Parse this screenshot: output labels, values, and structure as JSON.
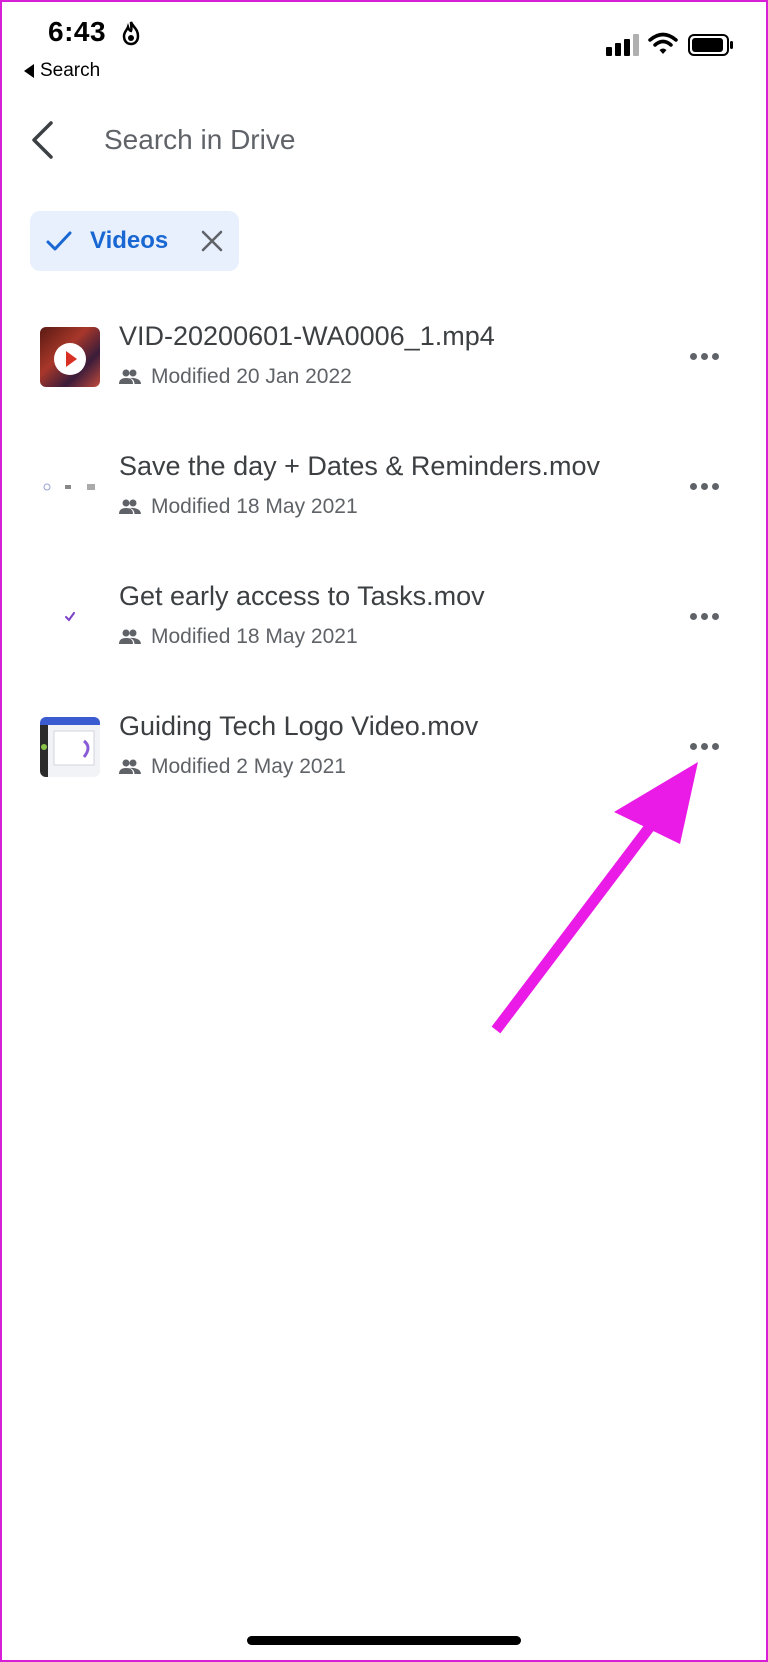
{
  "status_bar": {
    "time": "6:43",
    "back_label": "Search"
  },
  "header": {
    "search_placeholder": "Search in Drive"
  },
  "filter_chip": {
    "label": "Videos"
  },
  "files": [
    {
      "name": "VID-20200601-WA0006_1.mp4",
      "modified": "Modified 20 Jan 2022"
    },
    {
      "name": "Save the day + Dates & Reminders.mov",
      "modified": "Modified 18 May 2021"
    },
    {
      "name": "Get early access to Tasks.mov",
      "modified": "Modified 18 May 2021"
    },
    {
      "name": "Guiding Tech Logo Video.mov",
      "modified": "Modified 2 May 2021"
    }
  ],
  "colors": {
    "accent": "#1967d2",
    "chip_background": "#e8f0fe",
    "annotation_arrow": "#ea1be6"
  },
  "icons": [
    "fire-icon",
    "cellular-signal-icon",
    "wifi-icon",
    "battery-icon",
    "back-arrow-icon",
    "check-icon",
    "close-icon",
    "shared-people-icon",
    "more-options-icon"
  ]
}
